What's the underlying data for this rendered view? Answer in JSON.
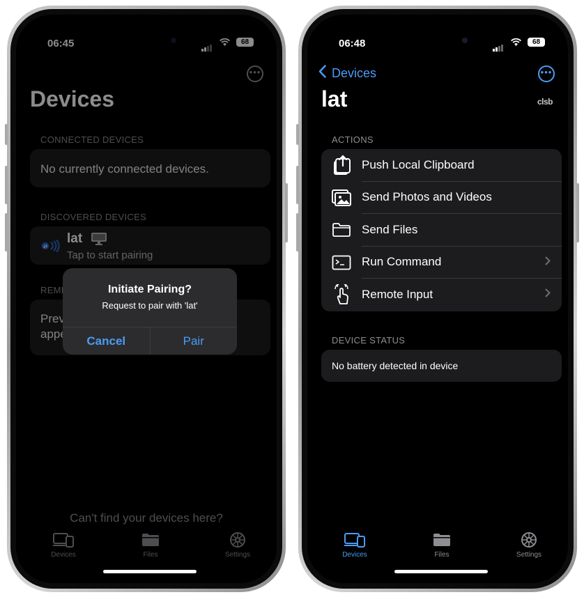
{
  "left_phone": {
    "status": {
      "time": "06:45",
      "battery": "68"
    },
    "title": "Devices",
    "connected_header": "CONNECTED DEVICES",
    "connected_empty": "No currently connected devices.",
    "discovered_header": "DISCOVERED DEVICES",
    "device": {
      "name": "lat",
      "subtitle": "Tap to start pairing"
    },
    "remembered_header_partial": "REME",
    "remembered_text_line1": "Prev",
    "remembered_text_line2": "appe",
    "alert": {
      "title": "Initiate Pairing?",
      "message": "Request to pair with 'lat'",
      "cancel": "Cancel",
      "confirm": "Pair"
    },
    "footer_hint": "Can't find your devices here?",
    "tabs": [
      {
        "label": "Devices",
        "icon": "devices-icon"
      },
      {
        "label": "Files",
        "icon": "folder-icon"
      },
      {
        "label": "Settings",
        "icon": "gear-icon"
      }
    ]
  },
  "right_phone": {
    "status": {
      "time": "06:48",
      "battery": "68"
    },
    "back_label": "Devices",
    "title": "lat",
    "badge": "clsb",
    "actions_header": "ACTIONS",
    "actions": [
      {
        "label": "Push Local Clipboard",
        "icon": "clipboard-upload-icon",
        "chevron": false
      },
      {
        "label": "Send Photos and Videos",
        "icon": "photos-icon",
        "chevron": false
      },
      {
        "label": "Send Files",
        "icon": "folder-icon",
        "chevron": false
      },
      {
        "label": "Run Command",
        "icon": "terminal-icon",
        "chevron": true
      },
      {
        "label": "Remote Input",
        "icon": "hand-pointer-icon",
        "chevron": true
      }
    ],
    "status_header": "DEVICE STATUS",
    "status_text": "No battery detected in device",
    "tabs": [
      {
        "label": "Devices",
        "icon": "devices-icon"
      },
      {
        "label": "Files",
        "icon": "folder-icon"
      },
      {
        "label": "Settings",
        "icon": "gear-icon"
      }
    ]
  },
  "colors": {
    "accent": "#4a9cf5",
    "background": "#000000",
    "card": "#1c1c1e",
    "secondary_text": "#8e8e93"
  }
}
